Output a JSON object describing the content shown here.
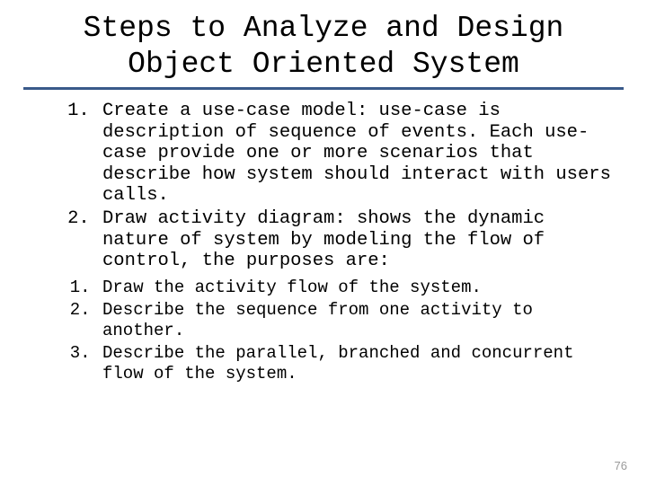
{
  "title_line1": "Steps to Analyze and Design",
  "title_line2": "Object Oriented System",
  "steps": {
    "item1": "Create a use-case model: use-case is description of sequence of events. Each use-case provide one or more scenarios that describe how system should interact with users calls.",
    "item2": "Draw activity diagram: shows the dynamic nature of system by modeling the flow of control, the purposes are:"
  },
  "sub": {
    "item1": "Draw the activity flow of the system.",
    "item2": "Describe the sequence from one activity to another.",
    "item3": "Describe the parallel, branched and concurrent flow of the system."
  },
  "page_number": "76"
}
